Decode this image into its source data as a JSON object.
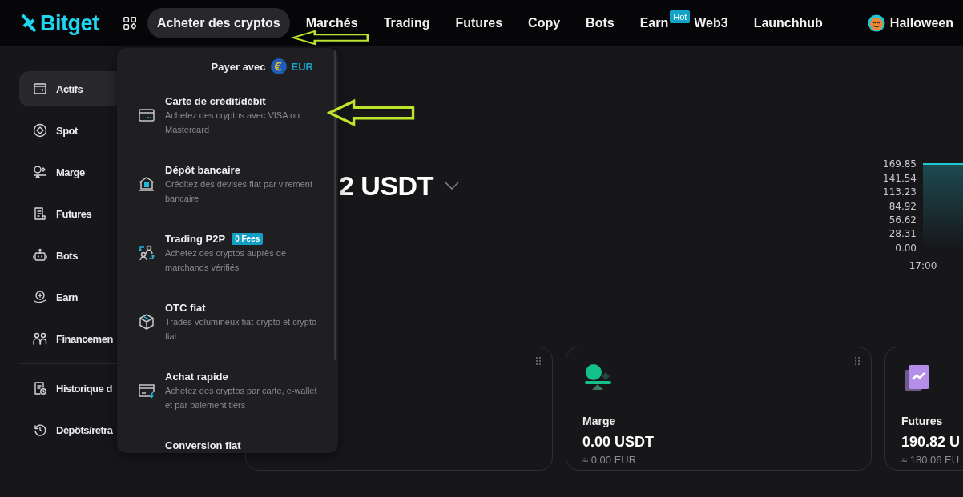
{
  "nav": {
    "logo": "Bitget",
    "items": [
      {
        "label": "Acheter des cryptos",
        "selected": true
      },
      {
        "label": "Marchés",
        "selected": false
      },
      {
        "label": "Trading",
        "selected": false
      },
      {
        "label": "Futures",
        "selected": false
      },
      {
        "label": "Copy",
        "selected": false
      },
      {
        "label": "Bots",
        "selected": false
      },
      {
        "label": "Earn",
        "selected": false,
        "badge": "Hot"
      },
      {
        "label": "Web3",
        "selected": false
      },
      {
        "label": "Launchhub",
        "selected": false
      },
      {
        "label": "Halloween",
        "selected": false,
        "kind": "event"
      }
    ]
  },
  "sidebar": {
    "groups": [
      {
        "items": [
          {
            "label": "Actifs",
            "selected": true
          },
          {
            "label": "Spot",
            "selected": false
          },
          {
            "label": "Marge",
            "selected": false
          },
          {
            "label": "Futures",
            "selected": false
          },
          {
            "label": "Bots",
            "selected": false
          },
          {
            "label": "Earn",
            "selected": false
          },
          {
            "label": "Financemen",
            "selected": false
          }
        ]
      },
      {
        "items": [
          {
            "label": "Historique d",
            "selected": false
          },
          {
            "label": "Dépôts/retra",
            "selected": false
          }
        ]
      }
    ]
  },
  "buy_menu": {
    "pay_label": "Payer avec",
    "currency": "EUR",
    "items": [
      {
        "title": "Carte de crédit/débit",
        "description": "Achetez des cryptos avec VISA ou Mastercard"
      },
      {
        "title": "Dépôt bancaire",
        "description": "Créditez des devises fiat par virement bancaire"
      },
      {
        "title": "Trading P2P",
        "badge": "0 Fees",
        "description": "Achetez des cryptos auprès de marchands vérifiés"
      },
      {
        "title": "OTC fiat",
        "description": "Trades volumineux fiat-crypto et crypto-fiat"
      },
      {
        "title": "Achat rapide",
        "description": "Achetez des cryptos par carte, e-wallet et par paiement tiers"
      },
      {
        "title": "Conversion fiat"
      }
    ]
  },
  "overview": {
    "balance": "2 USDT",
    "chart_data": {
      "type": "area",
      "categories": [
        "17:00"
      ],
      "ylim": [
        0,
        169.85
      ],
      "yticks": [
        {
          "value": 0,
          "label": "0.00"
        },
        {
          "value": 28.31,
          "label": "28.31"
        },
        {
          "value": 56.62,
          "label": "56.62"
        },
        {
          "value": 84.92,
          "label": "84.92"
        },
        {
          "value": 113.23,
          "label": "113.23"
        },
        {
          "value": 141.54,
          "label": "141.54"
        },
        {
          "value": 169.85,
          "label": "169.85"
        }
      ]
    }
  },
  "cards": [
    {
      "kind": "blank",
      "draggable": true
    },
    {
      "kind": "margin",
      "draggable": true,
      "name": "Marge",
      "amount": "0.00 USDT",
      "approx": "≈ 0.00 EUR"
    },
    {
      "kind": "futures",
      "draggable": false,
      "name": "Futures",
      "amount": "190.82 U",
      "approx": "≈ 180.06 EU"
    }
  ]
}
